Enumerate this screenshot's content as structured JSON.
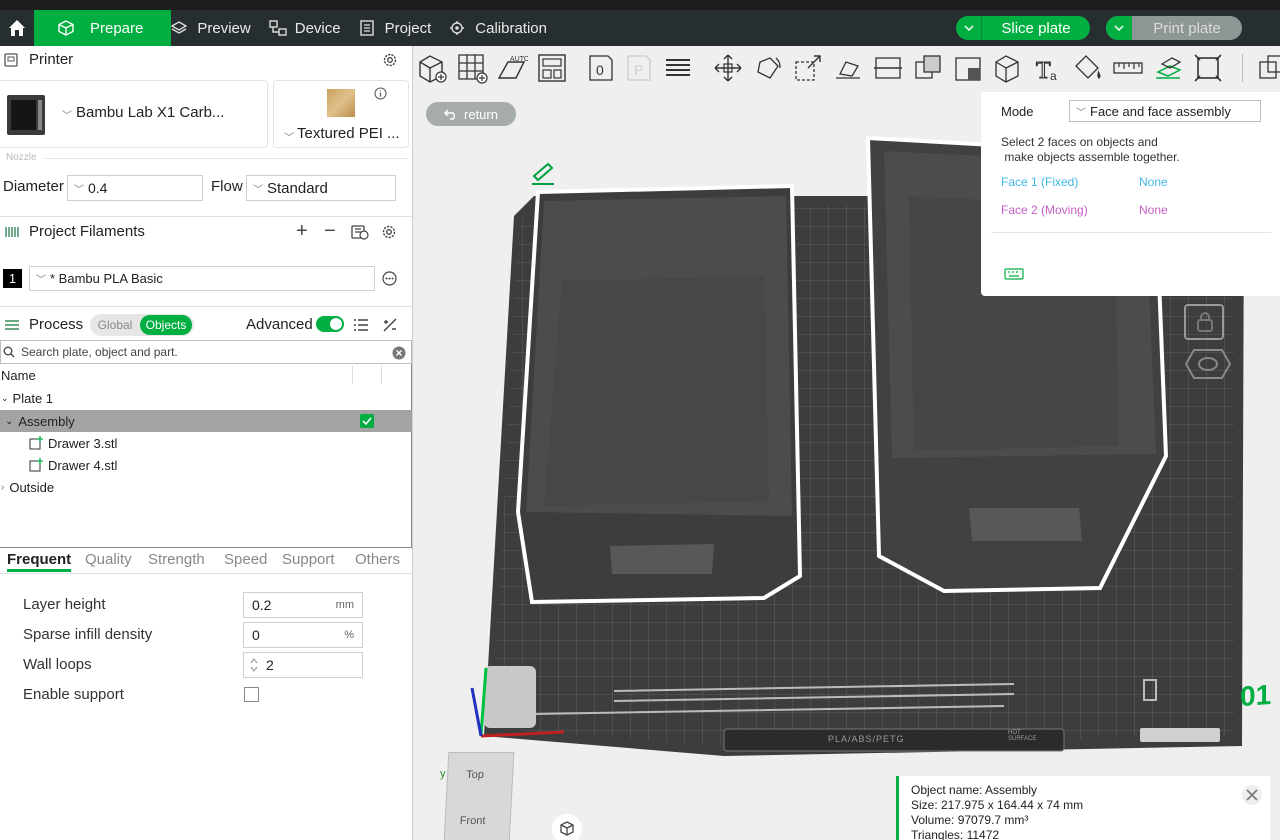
{
  "topbar": {
    "tabs": [
      {
        "label": "Prepare",
        "icon": "cube-icon",
        "active": true
      },
      {
        "label": "Preview",
        "icon": "layers-icon",
        "active": false
      },
      {
        "label": "Device",
        "icon": "device-icon",
        "active": false
      },
      {
        "label": "Project",
        "icon": "project-icon",
        "active": false
      },
      {
        "label": "Calibration",
        "icon": "calibration-icon",
        "active": false
      }
    ],
    "slice_label": "Slice plate",
    "print_label": "Print plate"
  },
  "printer": {
    "section_title": "Printer",
    "printer_name": "Bambu Lab X1 Carb...",
    "plate_name": "Textured PEI ...",
    "nozzle_caption": "Nozzle",
    "diameter_label": "Diameter",
    "diameter_value": "0.4",
    "flow_label": "Flow",
    "flow_value": "Standard"
  },
  "filaments": {
    "section_title": "Project Filaments",
    "items": [
      {
        "index": "1",
        "name": "* Bambu PLA Basic",
        "color": "#000000"
      }
    ]
  },
  "process": {
    "section_title": "Process",
    "toggle_global": "Global",
    "toggle_objects": "Objects",
    "advanced_label": "Advanced",
    "advanced_on": true
  },
  "search": {
    "placeholder": "Search plate, object and part."
  },
  "tree": {
    "header": "Name",
    "rows": [
      {
        "label": "Plate 1"
      },
      {
        "label": "Assembly"
      },
      {
        "label": "Drawer 3.stl"
      },
      {
        "label": "Drawer 4.stl"
      },
      {
        "label": "Outside"
      }
    ]
  },
  "param_tabs": [
    "Frequent",
    "Quality",
    "Strength",
    "Speed",
    "Support",
    "Others"
  ],
  "params": {
    "layer_height_label": "Layer height",
    "layer_height_value": "0.2",
    "layer_height_unit": "mm",
    "sparse_label": "Sparse infill density",
    "sparse_value": "0",
    "sparse_unit": "%",
    "wall_label": "Wall loops",
    "wall_value": "2",
    "support_label": "Enable support",
    "support_checked": false
  },
  "viewport": {
    "return_label": "return",
    "plate_number": "01",
    "plate_text": "PLA/ABS/PETG",
    "plate_hot": "HOT SURFACE",
    "cube_top": "Top",
    "cube_front": "Front",
    "axis_y": "y"
  },
  "assembly_panel": {
    "mode_label": "Mode",
    "mode_value": "Face and face assembly",
    "instruction_line1": "Select 2 faces on objects and",
    "instruction_line2": " make objects assemble together.",
    "face1_label": "Face 1 (Fixed)",
    "face1_value": "None",
    "face2_label": "Face 2 (Moving)",
    "face2_value": "None",
    "face1_color": "#3fb8e8",
    "face2_color": "#c55fc8"
  },
  "info": {
    "object_name": "Object name: Assembly",
    "size": "Size: 217.975 x 164.44 x 74 mm",
    "volume": "Volume: 97079.7 mm³",
    "triangles": "Triangles: 11472"
  },
  "colors": {
    "accent": "#00ae42",
    "topbar": "#262e30"
  }
}
